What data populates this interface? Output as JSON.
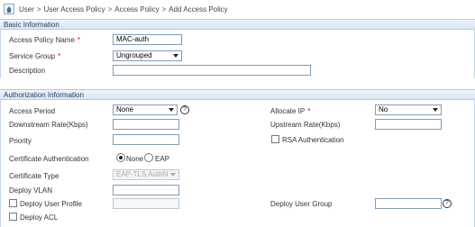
{
  "breadcrumb": {
    "items": [
      "User",
      "User Access Policy",
      "Access Policy",
      "Add Access Policy"
    ],
    "separator": ">"
  },
  "basic": {
    "title": "Basic Information",
    "policy_name_label": "Access Policy Name",
    "policy_name_value": "MAC-auth",
    "service_group_label": "Service Group",
    "service_group_value": "Ungrouped",
    "description_label": "Description",
    "description_value": "",
    "required_mark": "*"
  },
  "auth": {
    "title": "Authorization Information",
    "access_period_label": "Access Period",
    "access_period_value": "None",
    "allocate_ip_label": "Allocate IP",
    "allocate_ip_value": "No",
    "downstream_label": "Downstream Rate(Kbps)",
    "downstream_value": "",
    "upstream_label": "Upstream Rate(Kbps)",
    "upstream_value": "",
    "priority_label": "Priority",
    "priority_value": "",
    "rsa_label": "RSA Authentication",
    "cert_auth_label": "Certificate Authentication",
    "cert_auth_none": "None",
    "cert_auth_eap": "EAP",
    "cert_type_label": "Certificate Type",
    "cert_type_value": "EAP-TLS AuthN",
    "deploy_vlan_label": "Deploy VLAN",
    "deploy_vlan_value": "",
    "deploy_user_profile_label": "Deploy User Profile",
    "deploy_user_profile_value": "",
    "deploy_user_group_label": "Deploy User Group",
    "deploy_user_group_value": "",
    "deploy_acl_label": "Deploy ACL",
    "required_mark": "*"
  },
  "icons": {
    "home": "home-icon",
    "help": "help-icon"
  },
  "colors": {
    "header_bg": "#d9e6f4",
    "header_border": "#b7cbe2",
    "input_border": "#7f9db9",
    "required": "#dd0000"
  }
}
